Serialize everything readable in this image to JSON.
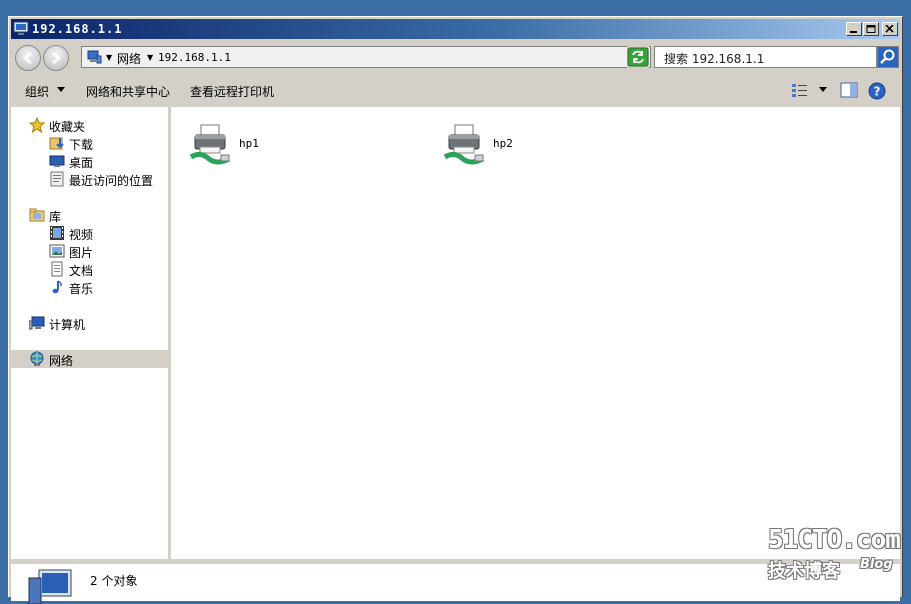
{
  "window": {
    "title": "192.168.1.1"
  },
  "address_bar": {
    "breadcrumbs": [
      "网络",
      "192.168.1.1"
    ]
  },
  "search": {
    "placeholder": "搜索 192.168.1.1"
  },
  "toolbar": {
    "organize_label": "组织",
    "network_center_label": "网络和共享中心",
    "remote_printers_label": "查看远程打印机"
  },
  "nav": {
    "favorites": {
      "label": "收藏夹",
      "items": [
        {
          "label": "下载",
          "icon": "download-folder-icon"
        },
        {
          "label": "桌面",
          "icon": "desktop-icon"
        },
        {
          "label": "最近访问的位置",
          "icon": "recent-places-icon"
        }
      ]
    },
    "libraries": {
      "label": "库",
      "items": [
        {
          "label": "视频",
          "icon": "video-icon"
        },
        {
          "label": "图片",
          "icon": "pictures-icon"
        },
        {
          "label": "文档",
          "icon": "documents-icon"
        },
        {
          "label": "音乐",
          "icon": "music-icon"
        }
      ]
    },
    "computer": {
      "label": "计算机"
    },
    "network": {
      "label": "网络",
      "selected": true
    }
  },
  "content": {
    "items": [
      {
        "label": "hp1",
        "icon": "network-printer-icon"
      },
      {
        "label": "hp2",
        "icon": "network-printer-icon"
      }
    ]
  },
  "status": {
    "text": "2 个对象"
  },
  "watermark": {
    "line1": "51CTO.com",
    "line2": "技术博客",
    "line3": "Blog"
  },
  "colors": {
    "title_start": "#0a246a",
    "title_end": "#a6caf0",
    "chrome": "#d4d0c8",
    "desktop": "#3a6ea5"
  }
}
